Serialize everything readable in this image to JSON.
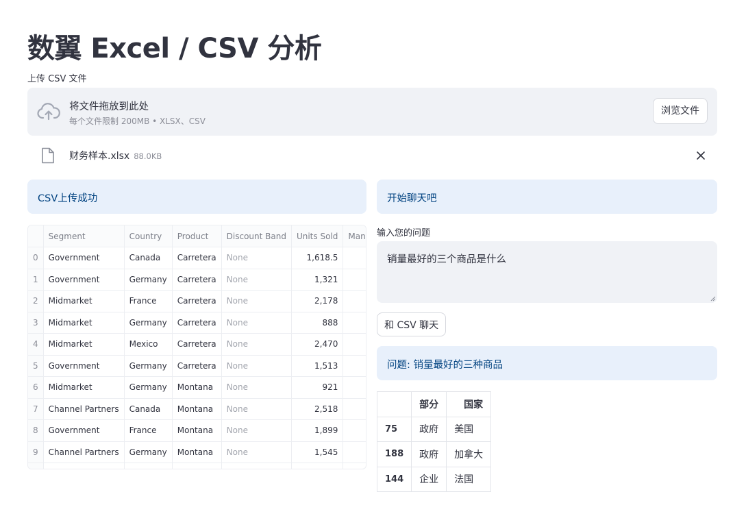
{
  "page_title": "数翼 Excel / CSV 分析",
  "uploader": {
    "label": "上传 CSV 文件",
    "drop_text": "将文件拖放到此处",
    "limit_text": "每个文件限制 200MB • XLSX、CSV",
    "browse_label": "浏览文件",
    "icon": "cloud-upload-icon"
  },
  "uploaded_file": {
    "name": "财务样本.xlsx",
    "size": "88.0KB",
    "icon": "file-icon"
  },
  "success_message": "CSV上传成功",
  "dataframe": {
    "columns": [
      "Segment",
      "Country",
      "Product",
      "Discount Band",
      "Units Sold",
      "Manufac"
    ],
    "rows": [
      {
        "index": "0",
        "segment": "Government",
        "country": "Canada",
        "product": "Carretera",
        "discount": "None",
        "units": "1,618.5"
      },
      {
        "index": "1",
        "segment": "Government",
        "country": "Germany",
        "product": "Carretera",
        "discount": "None",
        "units": "1,321"
      },
      {
        "index": "2",
        "segment": "Midmarket",
        "country": "France",
        "product": "Carretera",
        "discount": "None",
        "units": "2,178"
      },
      {
        "index": "3",
        "segment": "Midmarket",
        "country": "Germany",
        "product": "Carretera",
        "discount": "None",
        "units": "888"
      },
      {
        "index": "4",
        "segment": "Midmarket",
        "country": "Mexico",
        "product": "Carretera",
        "discount": "None",
        "units": "2,470"
      },
      {
        "index": "5",
        "segment": "Government",
        "country": "Germany",
        "product": "Carretera",
        "discount": "None",
        "units": "1,513"
      },
      {
        "index": "6",
        "segment": "Midmarket",
        "country": "Germany",
        "product": "Montana",
        "discount": "None",
        "units": "921"
      },
      {
        "index": "7",
        "segment": "Channel Partners",
        "country": "Canada",
        "product": "Montana",
        "discount": "None",
        "units": "2,518"
      },
      {
        "index": "8",
        "segment": "Government",
        "country": "France",
        "product": "Montana",
        "discount": "None",
        "units": "1,899"
      },
      {
        "index": "9",
        "segment": "Channel Partners",
        "country": "Germany",
        "product": "Montana",
        "discount": "None",
        "units": "1,545"
      }
    ]
  },
  "chat": {
    "header": "开始聊天吧",
    "input_label": "输入您的问题",
    "input_value": "销量最好的三个商品是什么",
    "button_label": "和 CSV 聊天",
    "question_banner": "问题: 销量最好的三种商品"
  },
  "result_table": {
    "columns": [
      "部分",
      "国家"
    ],
    "rows": [
      {
        "index": "75",
        "segment": "政府",
        "country": "美国"
      },
      {
        "index": "188",
        "segment": "政府",
        "country": "加拿大"
      },
      {
        "index": "144",
        "segment": "企业",
        "country": "法国"
      }
    ]
  },
  "colors": {
    "info_bg": "#e8f0fb",
    "info_text": "#004280",
    "dropzone_bg": "#f0f2f6",
    "text": "#31333f"
  }
}
